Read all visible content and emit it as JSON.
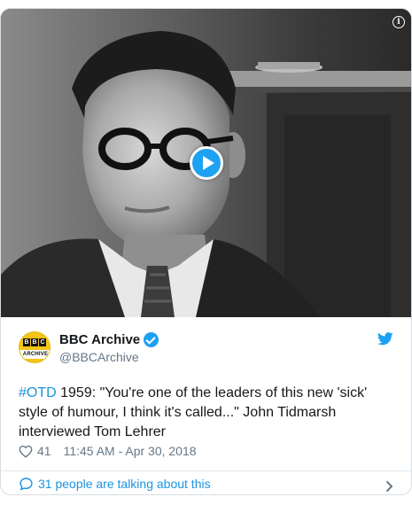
{
  "colors": {
    "accent": "#1da1f2",
    "link": "#1b95e0",
    "muted": "#657786",
    "text": "#14171a"
  },
  "media": {
    "type": "video",
    "play_icon": "play-icon",
    "info_icon": "info-icon",
    "info_glyph": "i"
  },
  "author": {
    "display_name": "BBC Archive",
    "handle": "@BBCArchive",
    "verified": true,
    "avatar_bbc": [
      "B",
      "B",
      "C"
    ],
    "avatar_caption": "ARCHIVE"
  },
  "tweet": {
    "hashtag": "#OTD",
    "text": " 1959: \"You're one of the leaders of this new 'sick' style of humour, I think it's called...\" John Tidmarsh interviewed Tom Lehrer"
  },
  "meta": {
    "likes": "41",
    "timestamp": "11:45 AM - Apr 30, 2018"
  },
  "footer": {
    "talking_label": "31 people are talking about this"
  }
}
